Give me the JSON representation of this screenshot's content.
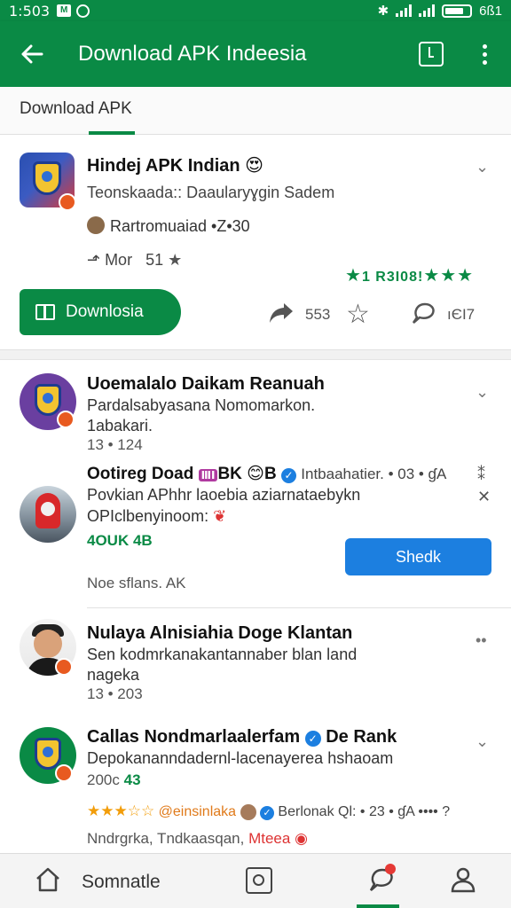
{
  "statusbar": {
    "time": "1:503",
    "right_text": "6ß1"
  },
  "appbar": {
    "title": "Download APK Indeesia"
  },
  "tabs": [
    {
      "label": "Download APK"
    }
  ],
  "featured": {
    "title": "Hindej APK Indian",
    "emoji": "😍",
    "subtitle": "Teonskaada:: Daaularyɣgin Sadem",
    "author": "Rartromuaiad •Z•30",
    "meta": "Mor   51",
    "rating_text": "1 R3I08!",
    "download_label": "Downlosia",
    "share_count": "553",
    "comment_count": "ıЄI7"
  },
  "list": [
    {
      "title": "Uoemalalo Daikam Reanuah",
      "subtitle": "Pardalsabyasana Nomomarkon.",
      "subtitle2": "1abakari.",
      "meta": "13 • 124"
    },
    {
      "title": "Ootireg Doad",
      "title_extra": "BK",
      "title_extra2": "B",
      "title_tail": "Intbaahatier. • 03 • ɠA",
      "subtitle": "Povkian APhhr laoebia aziarnataebykn",
      "subtitle2": "OPIclbenyinoom:",
      "tag": "4OUK 4B",
      "button_label": "Shedk",
      "footer": "Noe sflans. AK"
    },
    {
      "title": "Nulaya Alnisiahia Doge Klantan",
      "subtitle": "Sen kodmrkanakantannaber blan land",
      "subtitle2": "nageka",
      "meta": "13 • 203"
    },
    {
      "title": "Callas Nondmarlaalerfam",
      "title_tail": "De Rank",
      "subtitle": "Depokananndadernl-lacenayerea hshaoam",
      "meta_gray": "200c",
      "meta_green": "43",
      "reviewer": "@einsinlaka",
      "reviewer_tail": "Berlonak Ql: • 23 • ɠA ••••",
      "footer": "Nndrgrka, Tndkaasqan,",
      "footer_red": "Mteea"
    }
  ],
  "bottomnav": {
    "label": "Somnatle"
  },
  "colors": {
    "primary": "#0a8a45",
    "blue": "#1c7fe0",
    "orange": "#f29d0a"
  }
}
